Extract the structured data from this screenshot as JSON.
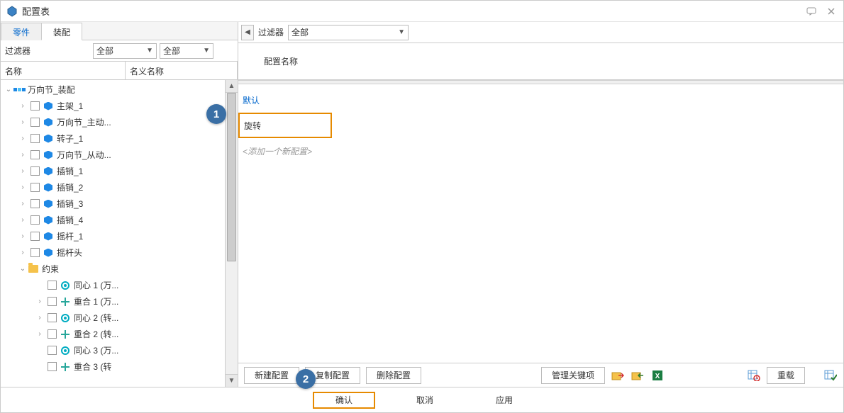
{
  "window": {
    "title": "配置表"
  },
  "left": {
    "tabs": {
      "parts": "零件",
      "assembly": "装配"
    },
    "filter_label": "过滤器",
    "filter1": "全部",
    "filter2": "全部",
    "col_name": "名称",
    "col_nominal": "名义名称",
    "root": "万向节_装配",
    "nodes": {
      "n0": "主架_1",
      "n1": "万向节_主动...",
      "n2": "转子_1",
      "n3": "万向节_从动...",
      "n4": "插销_1",
      "n5": "插销_2",
      "n6": "插销_3",
      "n7": "插销_4",
      "n8": "摇杆_1",
      "n9": "摇杆头"
    },
    "constraints_label": "约束",
    "constraints": {
      "c0": "同心 1 (万...",
      "c1": "重合 1 (万...",
      "c2": "同心 2 (转...",
      "c3": "重合 2 (转...",
      "c4": "同心 3 (万...",
      "c5": "重合 3 (转"
    }
  },
  "right": {
    "filter_label": "过滤器",
    "filter_value": "全部",
    "config_header": "配置名称",
    "config_default": "默认",
    "config_selected": "旋转",
    "config_placeholder": "<添加一个新配置>"
  },
  "toolbar": {
    "new_config": "新建配置",
    "copy_config": "复制配置",
    "delete_config": "删除配置",
    "manage_keys": "管理关键项",
    "reload": "重载"
  },
  "bottom": {
    "ok": "确认",
    "cancel": "取消",
    "apply": "应用"
  },
  "callouts": {
    "one": "1",
    "two": "2"
  }
}
